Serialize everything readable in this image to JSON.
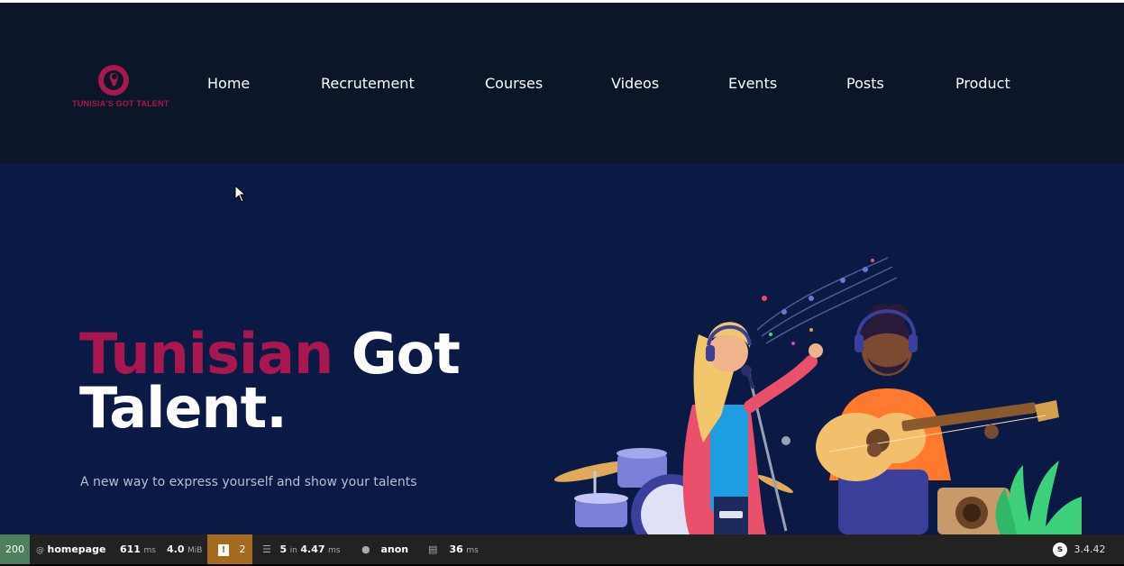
{
  "brand": {
    "logo_text": "TUNISIA'S GOT TALENT",
    "accent_color": "#a8174f",
    "nav_bg": "#0b1628",
    "hero_bg": "#0a1a45"
  },
  "nav": {
    "items": [
      {
        "label": "Home"
      },
      {
        "label": "Recrutement"
      },
      {
        "label": "Courses"
      },
      {
        "label": "Videos"
      },
      {
        "label": "Events"
      },
      {
        "label": "Posts"
      },
      {
        "label": "Product"
      }
    ]
  },
  "hero": {
    "title_accent": "Tunisian",
    "title_rest_line1": "Got",
    "title_line2": "Talent.",
    "subtitle": "A new way to express yourself and show your talents"
  },
  "debug_toolbar": {
    "status_code": "200",
    "route_prefix": "@",
    "route": "homepage",
    "time_value": "611",
    "time_unit": "ms",
    "memory_value": "4.0",
    "memory_unit": "MiB",
    "warning_count": "2",
    "cache_count": "5",
    "cache_in": "in",
    "cache_time": "4.47",
    "cache_unit": "ms",
    "user": "anon",
    "render_time": "36",
    "render_unit": "ms",
    "version": "3.4.42"
  }
}
